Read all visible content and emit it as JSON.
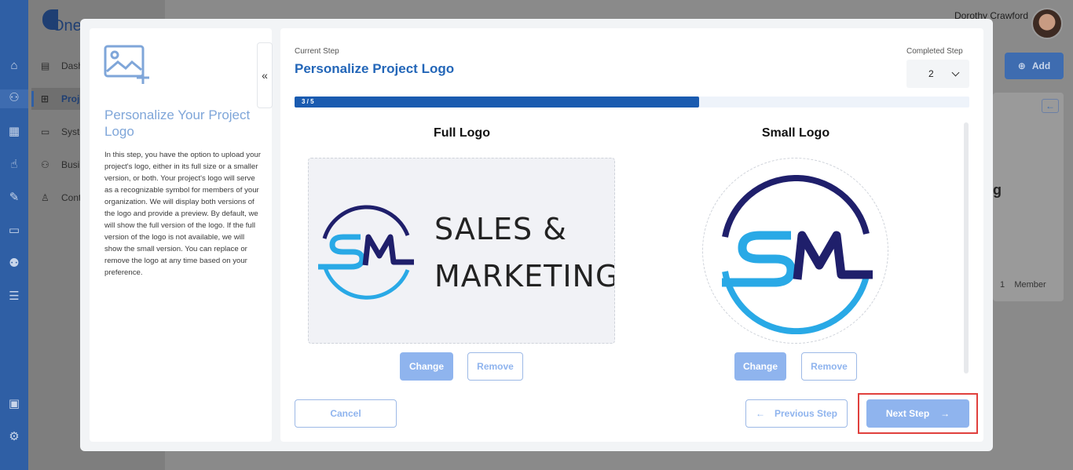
{
  "app": {
    "brand_text": "One"
  },
  "header": {
    "user_name": "Dorothy Crawford"
  },
  "sidebar": {
    "items": [
      {
        "label": "Dash",
        "icon": "dashboard-icon"
      },
      {
        "label": "Proje",
        "icon": "project-hierarchy-icon"
      },
      {
        "label": "Syste",
        "icon": "system-icon"
      },
      {
        "label": "Busi",
        "icon": "business-icon"
      },
      {
        "label": "Cont",
        "icon": "contact-icon"
      }
    ]
  },
  "background": {
    "add_label": "Add",
    "partial_heading": "g",
    "member_count": "1",
    "member_label": "Member"
  },
  "modal": {
    "left": {
      "title": "Personalize Your Project Logo",
      "description": "In this step, you have the option to upload your project's logo, either in its full size or a smaller version, or both. Your project's logo will serve as a recognizable symbol for members of your organization. We will display both versions of the logo and provide a preview. By default, we will show the full version of the logo. If the full version of the logo is not available, we will show the small version. You can replace or remove the logo at any time based on your preference."
    },
    "current_step_label": "Current Step",
    "current_step_title": "Personalize Project Logo",
    "completed_step_label": "Completed Step",
    "completed_step_value": "2",
    "progress": {
      "text": "3 / 5",
      "fraction": 0.6
    },
    "full_logo": {
      "heading": "Full Logo",
      "logo_line1": "SALES &",
      "logo_line2": "MARKETING",
      "monogram": "SM",
      "change_label": "Change",
      "remove_label": "Remove"
    },
    "small_logo": {
      "heading": "Small Logo",
      "monogram": "SM",
      "change_label": "Change",
      "remove_label": "Remove"
    },
    "footer": {
      "cancel_label": "Cancel",
      "previous_label": "Previous Step",
      "next_label": "Next Step"
    },
    "colors": {
      "accent": "#2366b8",
      "button_fill": "#8fb4ee",
      "logo_navy": "#1f1f6b",
      "logo_cyan": "#29a9e6",
      "highlight": "#e0403d"
    }
  }
}
